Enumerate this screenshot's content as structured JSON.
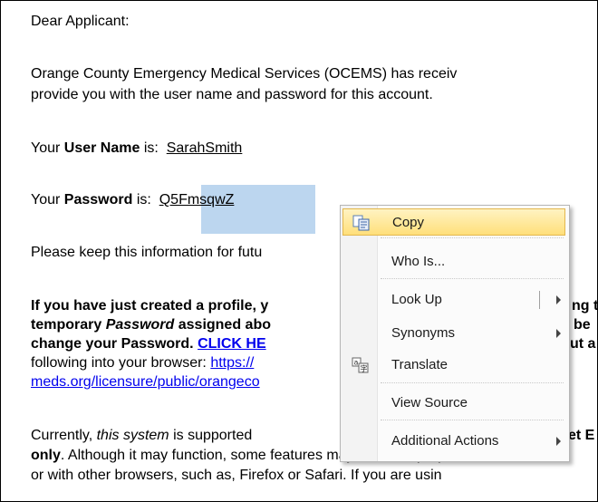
{
  "letter": {
    "greeting": "Dear Applicant:",
    "intro_1": "Orange County Emergency Medical Services (OCEMS) has receiv",
    "intro_2": "provide you with the user name and password for this account.",
    "username_prefix": "Your ",
    "username_label": "User Name",
    "username_suffix": " is:  ",
    "username_value": "SarahSmith",
    "password_prefix": "Your ",
    "password_label": "Password",
    "password_suffix": " is:  ",
    "password_value": "Q5FmsqwZ",
    "keep_info": "Please keep this information for futu",
    "profile_1_left": "If you have just created a profile, y",
    "profile_1_right": "ng t",
    "profile_2_a": "temporary ",
    "profile_2_b": "Password",
    "profile_2_c": " assigned abo",
    "profile_2_right": "be",
    "profile_3_a": "change your Password.  ",
    "profile_3_link": "CLICK HE",
    "profile_3_right": "ut a",
    "profile_4_a": "following into your browser: ",
    "profile_4_link": "https://",
    "profile_5_link": "meds.org/licensure/public/orangeco",
    "support_1_a": "Currently, ",
    "support_1_b": "this system",
    "support_1_c": " is supported",
    "support_1_right": "et E",
    "support_2_a": "only",
    "support_2_b": ".  Although it may function, some features may not work prop",
    "support_3": "or with other browsers, such as, Firefox or Safari.  If you are usin"
  },
  "context_menu": {
    "items": [
      {
        "label": "Copy",
        "icon": "copy-icon"
      },
      {
        "label": "Who Is...",
        "icon": ""
      },
      {
        "label": "Look Up",
        "icon": ""
      },
      {
        "label": "Synonyms",
        "icon": ""
      },
      {
        "label": "Translate",
        "icon": "translate-icon"
      },
      {
        "label": "View Source",
        "icon": ""
      },
      {
        "label": "Additional Actions",
        "icon": ""
      }
    ]
  }
}
